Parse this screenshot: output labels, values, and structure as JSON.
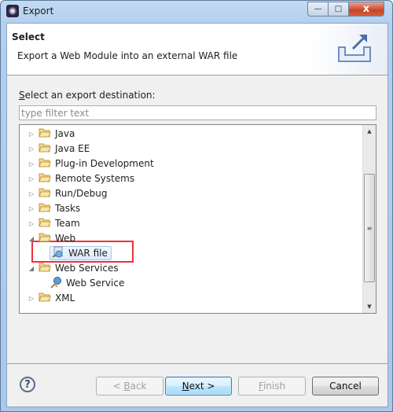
{
  "window": {
    "title": "Export",
    "controls": {
      "minimize": "—",
      "maximize": "□",
      "close": "x"
    }
  },
  "header": {
    "title": "Select",
    "description": "Export a Web Module into an external WAR file",
    "icon": "export-icon"
  },
  "destination": {
    "label_mnemonic": "S",
    "label_rest": "elect an export destination:",
    "filter_placeholder": "type filter text",
    "filter_value": ""
  },
  "tree": {
    "items": [
      {
        "label": "Java",
        "type": "folder",
        "expanded": false,
        "level": 0
      },
      {
        "label": "Java EE",
        "type": "folder",
        "expanded": false,
        "level": 0
      },
      {
        "label": "Plug-in Development",
        "type": "folder",
        "expanded": false,
        "level": 0
      },
      {
        "label": "Remote Systems",
        "type": "folder",
        "expanded": false,
        "level": 0
      },
      {
        "label": "Run/Debug",
        "type": "folder",
        "expanded": false,
        "level": 0
      },
      {
        "label": "Tasks",
        "type": "folder",
        "expanded": false,
        "level": 0
      },
      {
        "label": "Team",
        "type": "folder",
        "expanded": false,
        "level": 0
      },
      {
        "label": "Web",
        "type": "folder",
        "expanded": true,
        "level": 0
      },
      {
        "label": "WAR file",
        "type": "war-file",
        "selected": true,
        "highlighted": true,
        "level": 1
      },
      {
        "label": "Web Services",
        "type": "folder",
        "expanded": true,
        "level": 0
      },
      {
        "label": "Web Service",
        "type": "web-service",
        "level": 1
      },
      {
        "label": "XML",
        "type": "folder",
        "expanded": false,
        "level": 0
      }
    ],
    "scroll_position": 0.67,
    "scroll_thumb_fraction": 0.67,
    "highlight_color": "#f0303a"
  },
  "buttons": {
    "help": "?",
    "back": {
      "prefix": "< ",
      "mnemonic": "B",
      "rest": "ack",
      "enabled": false
    },
    "next": {
      "mnemonic": "N",
      "rest": "ext >",
      "enabled": true,
      "default": true
    },
    "finish": {
      "mnemonic": "F",
      "rest": "inish",
      "enabled": false
    },
    "cancel": {
      "label": "Cancel",
      "enabled": true
    }
  }
}
